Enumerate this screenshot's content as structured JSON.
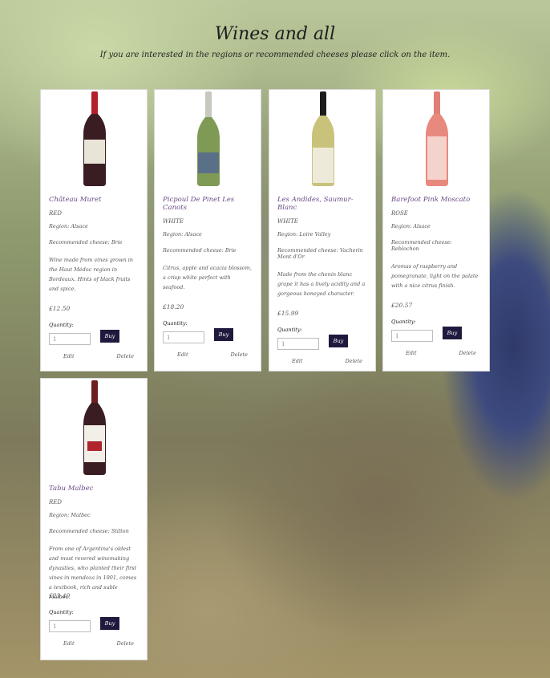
{
  "header": {
    "title": "Wines and all",
    "subtitle": "If you are interested in the regions or recommended cheeses please click on the item."
  },
  "labels": {
    "quantity": "Quantity:",
    "buy": "Buy",
    "edit": "Edit",
    "delete": "Delete"
  },
  "wines": [
    {
      "name": "Château Muret",
      "type": "RED",
      "region": "Region: Alsace",
      "cheese": "Recommended cheese: Brie",
      "description": "Wine made from vines grown in the Haut Médoc region in Bordeaux. Hints of black fruits and spice.",
      "price": "£12.50",
      "quantity": "1",
      "bottle_color": "#3a1d22",
      "label_color": "#e9e4d8"
    },
    {
      "name": "Picpoul De Pinet Les Canots",
      "type": "WHITE",
      "region": "Region: Alsace",
      "cheese": "Recommended cheese: Brie",
      "description": "Citrus, apple and acacia blossom, a crisp white perfect with seafood.",
      "price": "£18.20",
      "quantity": "1",
      "bottle_color": "#7f9a55",
      "label_color": "#5a6f88"
    },
    {
      "name": "Les Andides, Saumur-Blanc",
      "type": "WHITE",
      "region": "Region: Loire Valley",
      "cheese": "Recommended cheese: Vacherin Mont d'Or",
      "description": "Made from the chenin blanc grape it has a lively acidity and a gorgeous honeyed character.",
      "price": "£15.99",
      "quantity": "1",
      "bottle_color": "#2b2b22",
      "label_color": "#eeeada"
    },
    {
      "name": "Barefoot Pink Moscato",
      "type": "ROSE",
      "region": "Region: Alsace",
      "cheese": "Recommended cheese: Reblochon",
      "description": "Aromas of raspberry and pomegranate, light on the palate with a nice citrus finish.",
      "price": "£20.57",
      "quantity": "1",
      "bottle_color": "#e8897e",
      "label_color": "#f4d3cc"
    },
    {
      "name": "Tabu Malbec",
      "type": "RED",
      "region": "Region: Malbec",
      "cheese": "Recommended cheese: Stilton",
      "description": "From one of Argentina's oldest and most revered winemaking dynasties, who planted their first vines in mendoza in 1901, comes a textbook, rich and suble Malbec.",
      "price": "£23.40",
      "quantity": "1",
      "bottle_color": "#3a1d22",
      "label_color": "#f2efe8"
    }
  ]
}
